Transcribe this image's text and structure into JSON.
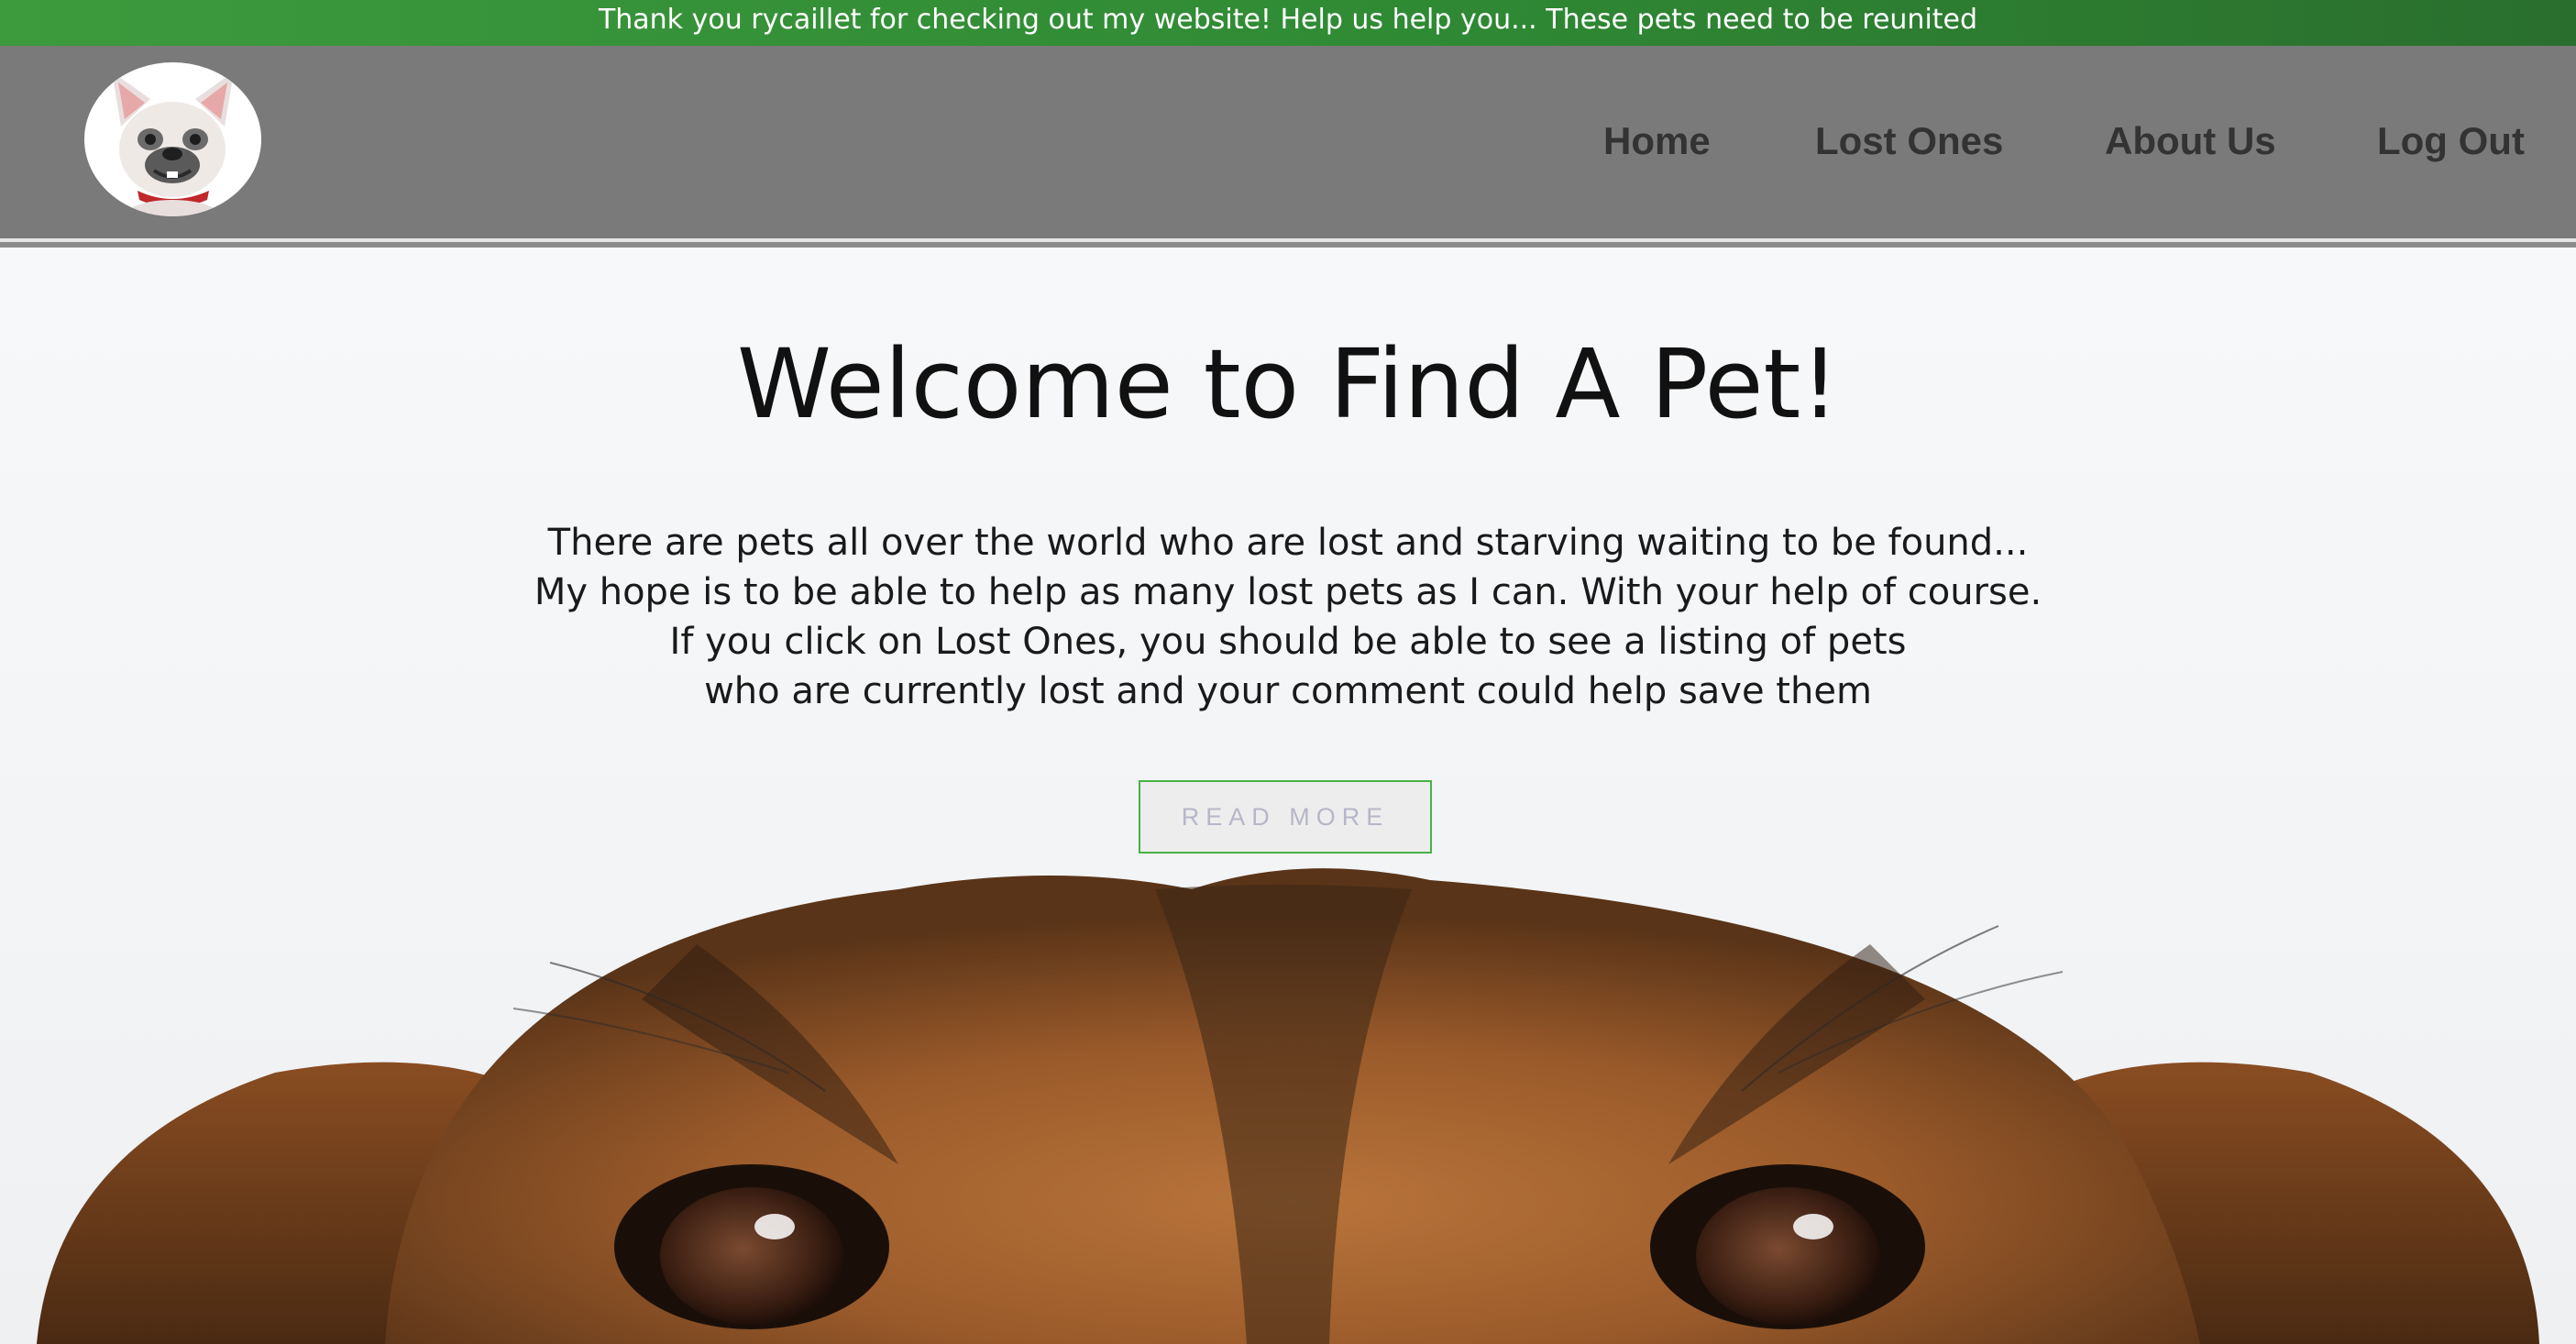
{
  "banner": {
    "text": "Thank you rycaillet for checking out my website! Help us help you... These pets need to be reunited"
  },
  "header": {
    "logo_icon": "french-bulldog-logo",
    "nav": [
      {
        "label": "Home"
      },
      {
        "label": "Lost Ones"
      },
      {
        "label": "About Us"
      },
      {
        "label": "Log Out"
      }
    ]
  },
  "hero": {
    "title": "Welcome to Find A Pet!",
    "lines": [
      "There are pets all over the world who are lost and starving waiting to be found...",
      "My hope is to be able to help as many lost pets as I can. With your help of course.",
      "If you click on Lost Ones, you should be able to see a listing of pets",
      "who are currently lost and your comment could help save them"
    ],
    "button_label": "READ MORE",
    "background_image": "peeking-dog-photo"
  },
  "colors": {
    "banner_green": "#3d9a3d",
    "header_gray": "#7a7a7a",
    "button_border": "#46b246",
    "nav_text": "#333333"
  }
}
